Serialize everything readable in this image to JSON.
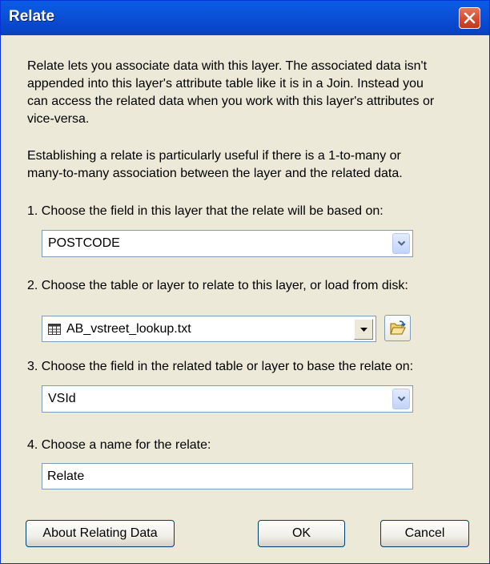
{
  "window": {
    "title": "Relate"
  },
  "intro": {
    "lines": [
      "Relate lets you associate data with this layer. The associated data isn't",
      "appended into this layer's attribute table like it is in a Join. Instead you",
      "can access the related data when you work with this layer's attributes or",
      "vice-versa."
    ]
  },
  "usefulness": {
    "lines": [
      "Establishing a relate is particularly useful if there is a 1-to-many or",
      "many-to-many association between the layer and the related data."
    ]
  },
  "step1": {
    "label": "1. Choose the field in this layer that the relate will be based on:",
    "value": "POSTCODE"
  },
  "step2": {
    "label": "2. Choose the table or layer to relate to this layer, or load from disk:",
    "value": "AB_vstreet_lookup.txt"
  },
  "step3": {
    "label": "3. Choose the field in the related table or layer to base the relate on:",
    "value": "VSId"
  },
  "step4": {
    "label": "4. Choose a name for the relate:",
    "value": "Relate"
  },
  "buttons": {
    "about": "About Relating Data",
    "ok": "OK",
    "cancel": "Cancel"
  },
  "icons": {
    "close": "close-icon",
    "dropdown": "chevron-down-icon",
    "table": "table-icon",
    "open_folder": "open-folder-icon"
  },
  "colors": {
    "titlebar": "#0a52d8",
    "close": "#d4472a",
    "dialog_bg": "#ece9d8"
  }
}
